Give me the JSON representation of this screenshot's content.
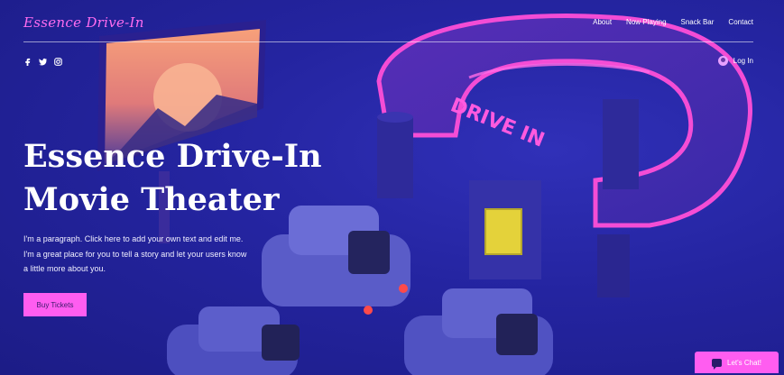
{
  "header": {
    "logo": "Essence Drive-In",
    "nav": [
      "About",
      "Now Playing",
      "Snack Bar",
      "Contact"
    ],
    "login_label": "Log In"
  },
  "social_icons": [
    "facebook-icon",
    "twitter-icon",
    "instagram-icon"
  ],
  "hero": {
    "title_lines": [
      "Essence Drive-In",
      "Movie Theater"
    ],
    "paragraph_lines": [
      "I'm a paragraph. Click here to add your own text and edit me.",
      "I'm a great place for you to tell a story and let your users know",
      "a little more about you."
    ],
    "cta_label": "Buy Tickets"
  },
  "scene": {
    "sign_text": "DRIVE IN"
  },
  "chat": {
    "label": "Let's Chat!"
  },
  "colors": {
    "accent": "#ff5df0",
    "background": "#2424a0",
    "neon": "#ff4fd8"
  }
}
